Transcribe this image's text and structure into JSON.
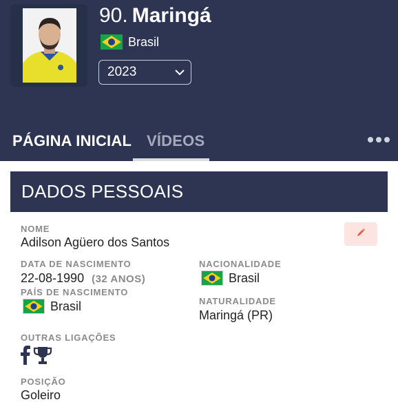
{
  "header": {
    "number": "90.",
    "club": "Maringá",
    "country": "Brasil",
    "year": "2023",
    "flag_colors": {
      "green": "#18a348",
      "yellow": "#f6d11c",
      "blue": "#1f3f8f"
    },
    "background": "#2d3553"
  },
  "tabs": [
    {
      "label": "PÁGINA INICIAL",
      "active": true
    },
    {
      "label": "VÍDEOS",
      "active": false
    }
  ],
  "section": {
    "title": "DADOS PESSOAIS",
    "fields": {
      "nome": {
        "label": "NOME",
        "value": "Adilson Agüero dos Santos"
      },
      "nascimento": {
        "label": "DATA DE NASCIMENTO",
        "value": "22-08-1990",
        "age": "(32 ANOS)"
      },
      "pais_nascimento": {
        "label": "PAÍS DE NASCIMENTO",
        "value": "Brasil"
      },
      "nacionalidade": {
        "label": "NACIONALIDADE",
        "value": "Brasil"
      },
      "naturalidade": {
        "label": "NATURALIDADE",
        "value": "Maringá (PR)"
      },
      "outras_ligacoes": {
        "label": "OUTRAS LIGAÇÕES",
        "icons": [
          "facebook-icon",
          "trophy-icon"
        ]
      },
      "posicao": {
        "label": "POSIÇÃO",
        "value": "Goleiro"
      }
    }
  }
}
